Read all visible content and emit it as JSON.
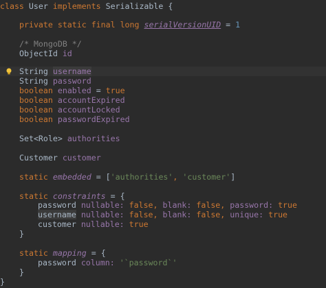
{
  "code": {
    "class_decl": {
      "kw_class": "class",
      "name": "User",
      "kw_implements": "implements",
      "iface": "Serializable",
      "brace": "{"
    },
    "serial": {
      "mods": "private static final long",
      "field": "serialVersionUID",
      "eq": "=",
      "value": "1"
    },
    "comment": "/* MongoDB */",
    "objectid": {
      "type": "ObjectId",
      "name": "id"
    },
    "fields": [
      {
        "type": "String",
        "name": "username"
      },
      {
        "type": "String",
        "name": "password"
      },
      {
        "type": "boolean",
        "name": "enabled",
        "eq": "=",
        "value": "true"
      },
      {
        "type": "boolean",
        "name": "accountExpired"
      },
      {
        "type": "boolean",
        "name": "accountLocked"
      },
      {
        "type": "boolean",
        "name": "passwordExpired"
      }
    ],
    "authorities": {
      "type": "Set<Role>",
      "name": "authorities"
    },
    "customer": {
      "type": "Customer",
      "name": "customer"
    },
    "embedded": {
      "kw": "static",
      "name": "embedded",
      "open": "= [",
      "s1": "'authorities'",
      "comma": ",",
      "s2": "'customer'",
      "close": "]"
    },
    "constraints": {
      "kw": "static",
      "name": "constraints",
      "open": "= {",
      "lines": [
        {
          "field": "password",
          "body": "nullable: false, blank: false, password: true"
        },
        {
          "field": "username",
          "body": "nullable: false, blank: false, unique: true"
        },
        {
          "field": "customer",
          "body": "nullable: true"
        }
      ],
      "close": "}"
    },
    "mapping": {
      "kw": "static",
      "name": "mapping",
      "open": "= {",
      "field": "password",
      "label": "column:",
      "value": "'`password`'",
      "close": "}"
    },
    "class_close": "}"
  },
  "colors": {
    "background": "#2b2b2b",
    "keyword": "#cc7832",
    "field": "#9876aa",
    "string": "#6a8759",
    "number": "#6897bb",
    "comment": "#808080",
    "text": "#a9b7c6",
    "bulb": "#f0c33c"
  },
  "icons": {
    "intention": "lightbulb-icon"
  }
}
